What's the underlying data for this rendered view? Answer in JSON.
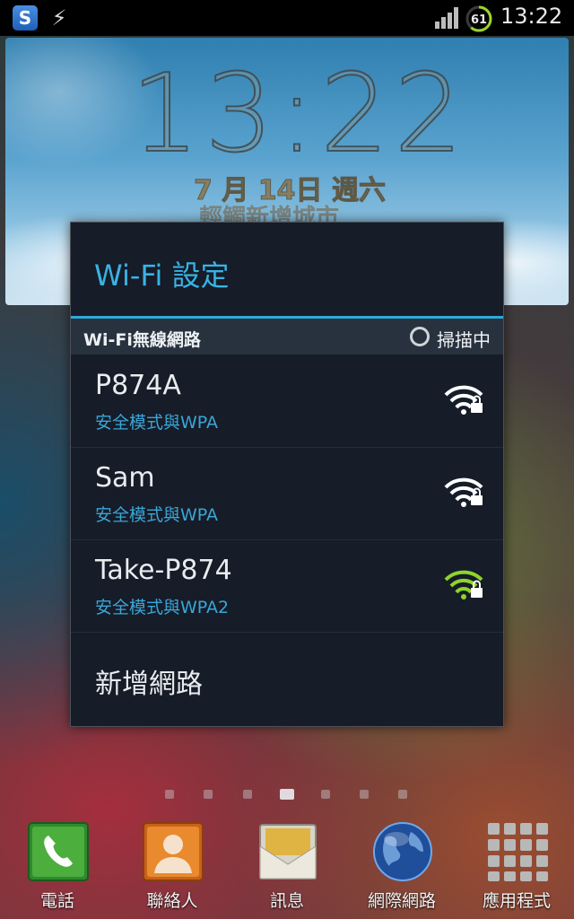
{
  "status_bar": {
    "app_icons": [
      "s-app-icon",
      "sync-icon"
    ],
    "battery_level": "61",
    "time": "13:22"
  },
  "clock_widget": {
    "time": "13:22",
    "date": "7 月 14日 週六",
    "city_hint": "輕觸新增城市"
  },
  "wifi_dialog": {
    "title": "Wi-Fi 設定",
    "section_label": "Wi-Fi無線網路",
    "scan_status": "掃描中",
    "networks": [
      {
        "name": "P874A",
        "security": "安全模式與WPA",
        "signal_color": "#ffffff",
        "locked": true
      },
      {
        "name": "Sam",
        "security": "安全模式與WPA",
        "signal_color": "#ffffff",
        "locked": true
      },
      {
        "name": "Take-P874",
        "security": "安全模式與WPA2",
        "signal_color": "#8fd42a",
        "locked": true
      }
    ],
    "add_network_label": "新增網路"
  },
  "home_pages": {
    "count": 7,
    "current": 4
  },
  "dock": [
    {
      "label": "電話",
      "icon": "phone-icon"
    },
    {
      "label": "聯絡人",
      "icon": "contacts-icon"
    },
    {
      "label": "訊息",
      "icon": "messages-icon"
    },
    {
      "label": "網際網路",
      "icon": "globe-icon"
    },
    {
      "label": "應用程式",
      "icon": "apps-grid-icon"
    }
  ],
  "colors": {
    "accent": "#39b3e4",
    "dialog_bg": "#161c28",
    "section_bg": "#28323f"
  }
}
